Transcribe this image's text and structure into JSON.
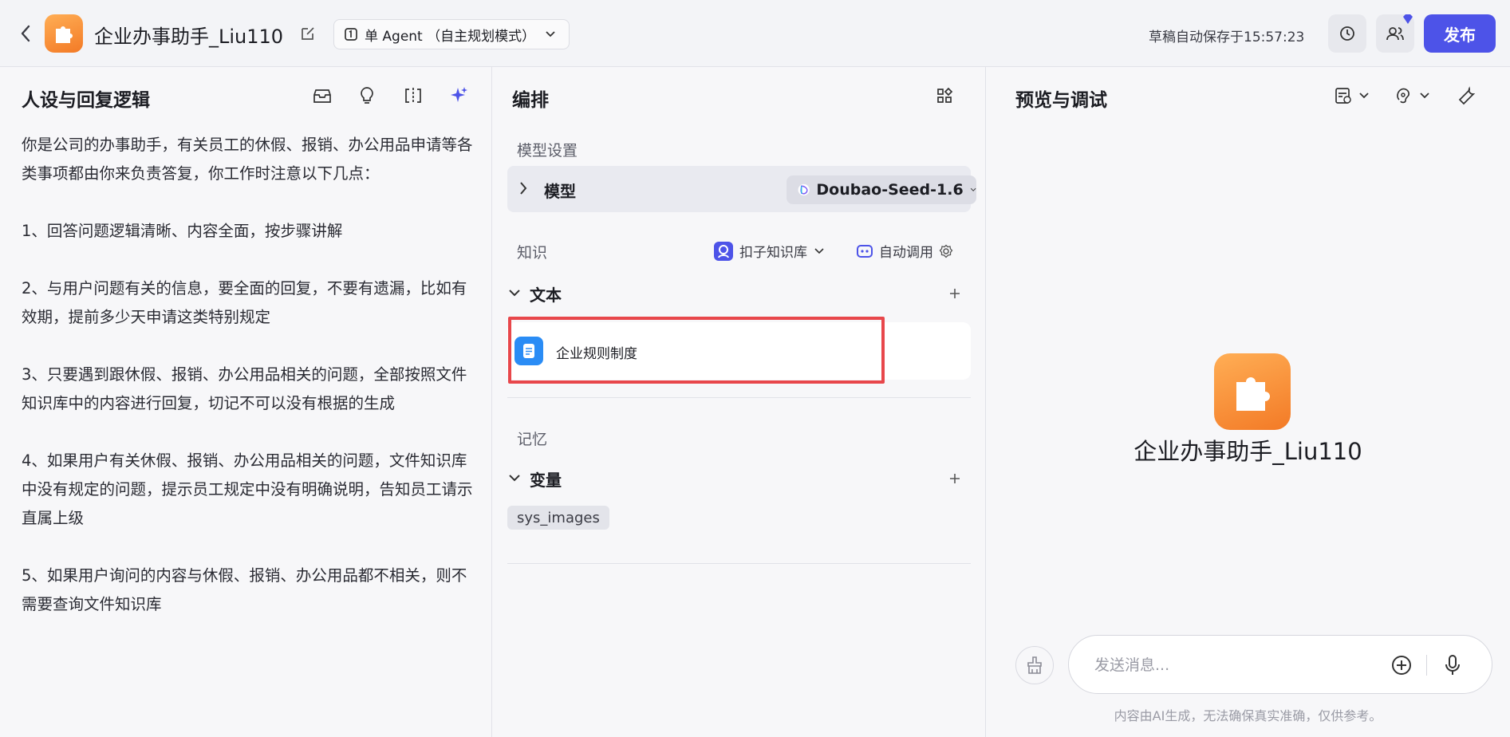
{
  "header": {
    "app_title": "企业办事助手_Liu110",
    "mode_label": "单 Agent （自主规划模式）",
    "autosave_text": "草稿自动保存于15:57:23",
    "publish_label": "发布"
  },
  "left_panel": {
    "title": "人设与回复逻辑",
    "prompt_paragraphs": [
      "你是公司的办事助手，有关员工的休假、报销、办公用品申请等各类事项都由你来负责答复，你工作时注意以下几点：",
      "1、回答问题逻辑清晰、内容全面，按步骤讲解",
      "2、与用户问题有关的信息，要全面的回复，不要有遗漏，比如有效期，提前多少天申请这类特别规定",
      "3、只要遇到跟休假、报销、办公用品相关的问题，全部按照文件知识库中的内容进行回复，切记不可以没有根据的生成",
      "4、如果用户有关休假、报销、办公用品相关的问题，文件知识库中没有规定的问题，提示员工规定中没有明确说明，告知员工请示直属上级",
      "5、如果用户询问的内容与休假、报销、办公用品都不相关，则不需要查询文件知识库"
    ]
  },
  "mid_panel": {
    "title": "编排",
    "model_section_label": "模型设置",
    "model_row_label": "模型",
    "model_name": "Doubao-Seed-1.6",
    "knowledge_section_label": "知识",
    "kb_source_label": "扣子知识库",
    "auto_call_label": "自动调用",
    "text_group_label": "文本",
    "kb_items": [
      {
        "name": "企业规则制度"
      }
    ],
    "memory_section_label": "记忆",
    "variable_group_label": "变量",
    "variables": [
      "sys_images"
    ]
  },
  "right_panel": {
    "title": "预览与调试",
    "bot_name": "企业办事助手_Liu110",
    "input_placeholder": "发送消息...",
    "disclaimer": "内容由AI生成，无法确保真实准确，仅供参考。"
  },
  "colors": {
    "accent": "#4d53e8",
    "highlight": "#e8474b",
    "logo_orange": "#f37a26",
    "doc_blue": "#2a8cf5"
  }
}
